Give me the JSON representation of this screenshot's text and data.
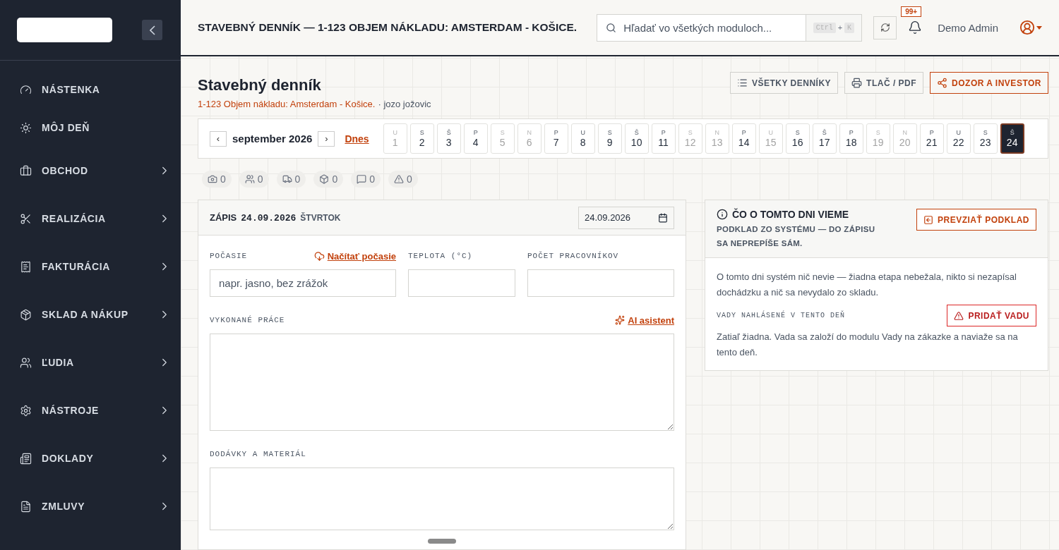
{
  "sidebar": {
    "items": [
      {
        "label": "NÁSTENKA",
        "submenu": false
      },
      {
        "label": "MÔJ DEŇ",
        "submenu": false
      },
      {
        "label": "OBCHOD",
        "submenu": true
      },
      {
        "label": "REALIZÁCIA",
        "submenu": true
      },
      {
        "label": "FAKTURÁCIA",
        "submenu": true
      },
      {
        "label": "SKLAD A NÁKUP",
        "submenu": true
      },
      {
        "label": "ĽUDIA",
        "submenu": true
      },
      {
        "label": "NÁSTROJE",
        "submenu": true
      },
      {
        "label": "DOKLADY",
        "submenu": true
      },
      {
        "label": "ZMLUVY",
        "submenu": true
      }
    ]
  },
  "header": {
    "title": "STAVEBNÝ DENNÍK — 1-123 OBJEM NÁKLADU: AMSTERDAM - KOŠICE.",
    "search": {
      "placeholder": "Hľadať vo všetkých moduloch...",
      "keys": [
        "Ctrl",
        "K"
      ],
      "joiner": "+"
    },
    "notifications": "99+",
    "user": "Demo Admin"
  },
  "page": {
    "title": "Stavebný denník",
    "project": "1-123 Objem nákladu: Amsterdam - Košice.",
    "author": "· jozo jožovic",
    "actions": [
      {
        "label": "VŠETKY DENNÍKY",
        "kind": "plain"
      },
      {
        "label": "TLAČ / PDF",
        "kind": "plain"
      },
      {
        "label": "DOZOR A INVESTOR",
        "kind": "accent"
      }
    ]
  },
  "calendar": {
    "prev": "‹",
    "month": "september 2026",
    "next": "›",
    "today": "Dnes",
    "days": [
      {
        "weekday": "U",
        "day": "1",
        "muted": true,
        "selected": false
      },
      {
        "weekday": "S",
        "day": "2",
        "muted": false,
        "selected": false
      },
      {
        "weekday": "Š",
        "day": "3",
        "muted": false,
        "selected": false
      },
      {
        "weekday": "P",
        "day": "4",
        "muted": false,
        "selected": false
      },
      {
        "weekday": "S",
        "day": "5",
        "muted": true,
        "selected": false
      },
      {
        "weekday": "N",
        "day": "6",
        "muted": true,
        "selected": false
      },
      {
        "weekday": "P",
        "day": "7",
        "muted": false,
        "selected": false
      },
      {
        "weekday": "U",
        "day": "8",
        "muted": false,
        "selected": false
      },
      {
        "weekday": "S",
        "day": "9",
        "muted": false,
        "selected": false
      },
      {
        "weekday": "Š",
        "day": "10",
        "muted": false,
        "selected": false
      },
      {
        "weekday": "P",
        "day": "11",
        "muted": false,
        "selected": false
      },
      {
        "weekday": "S",
        "day": "12",
        "muted": true,
        "selected": false
      },
      {
        "weekday": "N",
        "day": "13",
        "muted": true,
        "selected": false
      },
      {
        "weekday": "P",
        "day": "14",
        "muted": false,
        "selected": false
      },
      {
        "weekday": "U",
        "day": "15",
        "muted": true,
        "selected": false
      },
      {
        "weekday": "S",
        "day": "16",
        "muted": false,
        "selected": false
      },
      {
        "weekday": "Š",
        "day": "17",
        "muted": false,
        "selected": false
      },
      {
        "weekday": "P",
        "day": "18",
        "muted": false,
        "selected": false
      },
      {
        "weekday": "S",
        "day": "19",
        "muted": true,
        "selected": false
      },
      {
        "weekday": "N",
        "day": "20",
        "muted": true,
        "selected": false
      },
      {
        "weekday": "P",
        "day": "21",
        "muted": false,
        "selected": false
      },
      {
        "weekday": "U",
        "day": "22",
        "muted": false,
        "selected": false
      },
      {
        "weekday": "S",
        "day": "23",
        "muted": false,
        "selected": false
      },
      {
        "weekday": "Š",
        "day": "24",
        "muted": false,
        "selected": true
      }
    ]
  },
  "stats": [
    {
      "count": "0"
    },
    {
      "count": "0"
    },
    {
      "count": "0"
    },
    {
      "count": "0"
    },
    {
      "count": "0"
    },
    {
      "count": "0"
    }
  ],
  "entry": {
    "label": "ZÁPIS",
    "date": "24.09.2026",
    "weekday": "ŠTVRTOK",
    "date_value": "24.09.2026",
    "weather": {
      "label": "POČASIE",
      "action": "Načítať počasie",
      "placeholder": "napr. jasno, bez zrážok"
    },
    "temperature": {
      "label": "TEPLOTA (°C)"
    },
    "workers": {
      "label": "POČET PRACOVNÍKOV"
    },
    "work": {
      "label": "VYKONANÉ PRÁCE",
      "action": "AI asistent"
    },
    "deliveries": {
      "label": "DODÁVKY A MATERIÁL"
    }
  },
  "info": {
    "title": "ČO O TOMTO DNI VIEME",
    "subtitle": "PODKLAD ZO SYSTÉMU — DO ZÁPISU SA NEPREPÍŠE SÁM.",
    "button": "PREVZIAŤ PODKLAD",
    "text": "O tomto dni systém nič nevie — žiadna etapa nebežala, nikto si nezapísal dochádzku a nič sa nevydalo zo skladu.",
    "defects_label": "VADY NAHLÁSENÉ V TENTO DEŇ",
    "defects_button": "PRIDAŤ VADU",
    "defects_text": "Zatiaľ žiadna. Vada sa založí do modulu Vady na zákazke a naviaže sa na tento deň."
  }
}
